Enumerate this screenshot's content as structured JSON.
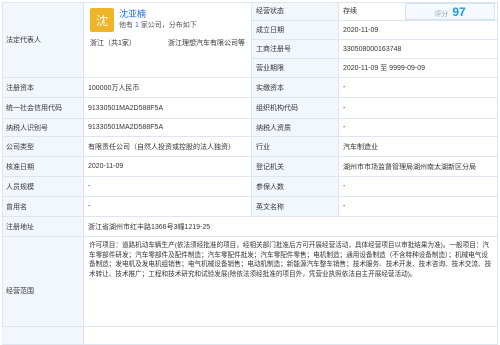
{
  "legal_rep": {
    "label": "法定代表人",
    "avatar_char": "沈",
    "name": "沈亚楠",
    "summary_prefix": "他有",
    "summary_count": "1",
    "summary_suffix": "家公司，分布如下",
    "region": "浙江（共1家）",
    "company": "浙江理想汽车有限公司等"
  },
  "status": {
    "label": "经营状态",
    "value": "存续"
  },
  "score": {
    "label": "评分",
    "value": "97"
  },
  "established": {
    "label": "成立日期",
    "value": "2020-11-09"
  },
  "reg_no": {
    "label": "工商注册号",
    "value": "330508000163748"
  },
  "term": {
    "label": "营业期限",
    "value": "2020-11-09 至 9999-09-09"
  },
  "capital": {
    "label": "注册资本",
    "value": "100000万人民币"
  },
  "paid_capital": {
    "label": "实缴资本",
    "value": "-"
  },
  "credit_code": {
    "label": "统一社会信用代码",
    "value": "91330501MA2D588F5A"
  },
  "org_code": {
    "label": "组织机构代码",
    "value": "-"
  },
  "tax_id": {
    "label": "纳税人识别号",
    "value": "91330501MA2D588F5A"
  },
  "taxpayer_quality": {
    "label": "纳税人资质",
    "value": "-"
  },
  "company_type": {
    "label": "公司类型",
    "value": "有限责任公司（自然人投资或控股的法人独资）"
  },
  "industry": {
    "label": "行业",
    "value": "汽车制造业"
  },
  "approval_date": {
    "label": "核准日期",
    "value": "2020-11-09"
  },
  "authority": {
    "label": "登记机关",
    "value": "湖州市市场监督管理局湖州南太湖新区分局"
  },
  "staff_size": {
    "label": "人员规模",
    "value": "-"
  },
  "insured": {
    "label": "参保人数",
    "value": "-"
  },
  "former_name": {
    "label": "曾用名",
    "value": "-"
  },
  "english_name": {
    "label": "英文名称",
    "value": "-"
  },
  "address": {
    "label": "注册地址",
    "value": "浙江省湖州市红丰路1366号3幢1219-25"
  },
  "scope": {
    "label": "经营范围",
    "value": "许可项目：道路机动车辆生产(依法须经批准的项目，经相关部门批准后方可开展经营活动，具体经营项目以审批结果为准)。一般项目：汽车零部件研发；汽车零部件及配件制造；汽车零配件批发；汽车零配件零售；电机制造；通用设备制造（不含特种设备制造）；机械电气设备制造；发电机及发电机组销售；电气机械设备销售；电动机制造；新能源汽车整车销售；技术服务、技术开发、技术咨询、技术交流、技术转让、技术推广；工程和技术研究和试验发展(除依法须经批准的项目外，凭营业执照依法自主开展经营活动)。"
  }
}
